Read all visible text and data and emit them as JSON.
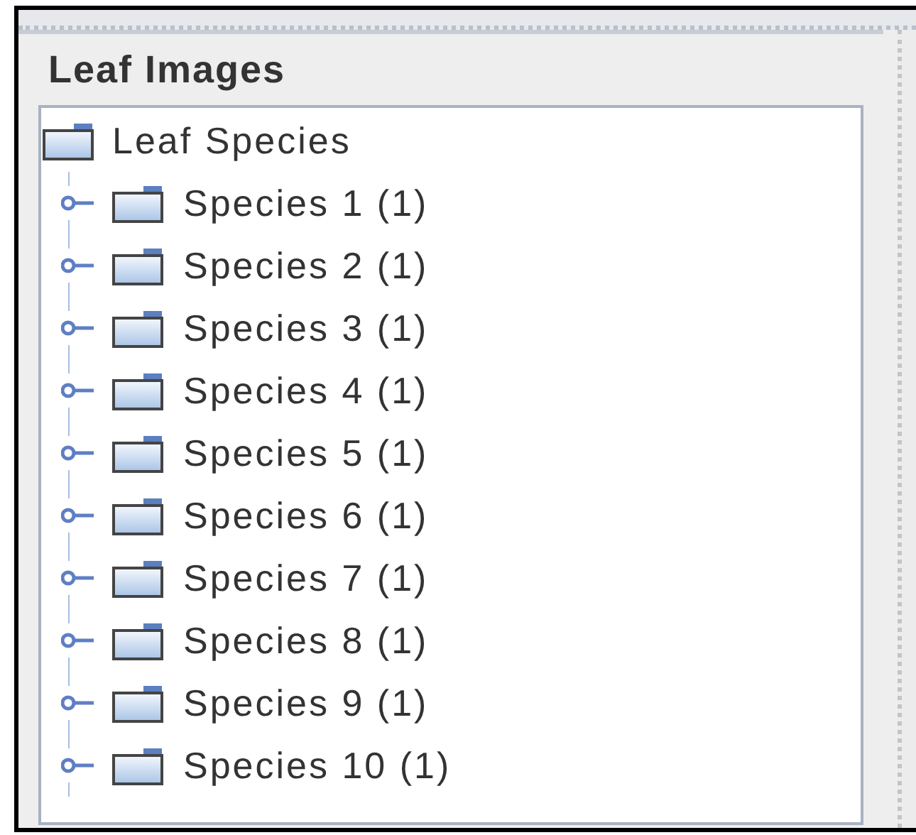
{
  "panel": {
    "title": "Leaf Images"
  },
  "tree": {
    "label": "Leaf Species",
    "children": [
      {
        "label": "Species 1 (1)",
        "expanded": false
      },
      {
        "label": "Species 2 (1)",
        "expanded": false
      },
      {
        "label": "Species 3 (1)",
        "expanded": false
      },
      {
        "label": "Species 4 (1)",
        "expanded": false
      },
      {
        "label": "Species 5 (1)",
        "expanded": false
      },
      {
        "label": "Species 6 (1)",
        "expanded": false
      },
      {
        "label": "Species 7 (1)",
        "expanded": false
      },
      {
        "label": "Species 8 (1)",
        "expanded": false
      },
      {
        "label": "Species 9 (1)",
        "expanded": false
      },
      {
        "label": "Species 10 (1)",
        "expanded": false
      }
    ]
  }
}
